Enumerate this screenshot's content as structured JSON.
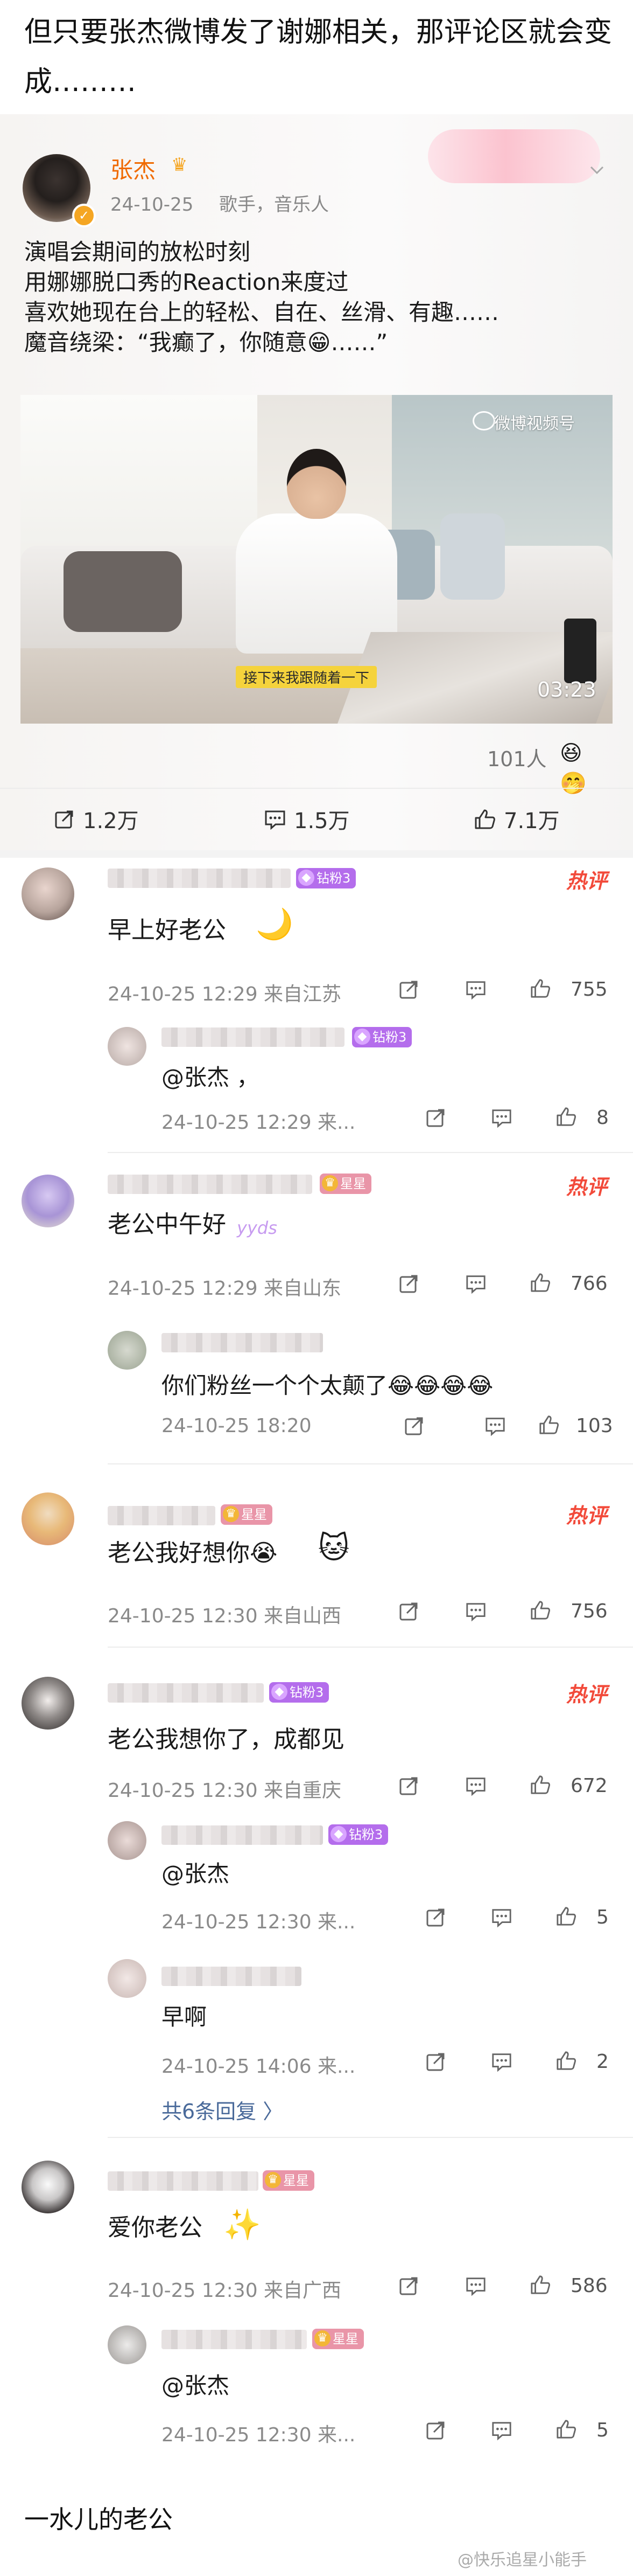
{
  "intro": {
    "line1": "但只要张杰微博发了谢娜相关，那评论区就会变",
    "line2": "成………"
  },
  "post": {
    "author": "张杰",
    "date": "24-10-25",
    "tags": "歌手，音乐人",
    "text_lines": [
      "演唱会期间的放松时刻",
      "用娜娜脱口秀的Reaction来度过",
      "喜欢她现在台上的轻松、自在、丝滑、有趣……",
      "魔音绕梁：“我癫了，你随意😁……”"
    ],
    "video": {
      "watermark": "微博视频号",
      "subtitle": "接下来我跟随着一下",
      "duration": "03:23"
    },
    "views": "101人",
    "actions": {
      "share": "1.2万",
      "comment": "1.5万",
      "like": "7.1万"
    }
  },
  "comments": [
    {
      "badge": "钻粉3",
      "hot": "热评",
      "text": "早上好老公",
      "meta": "24-10-25 12:29  来自江苏",
      "likes": "755",
      "replies": [
        {
          "badge": "钻粉3",
          "text": "@张杰 ，",
          "meta": "24-10-25 12:29  来...",
          "likes": "8"
        }
      ]
    },
    {
      "badge": "星星",
      "hot": "热评",
      "text": "老公中午好",
      "sticker": "yyds",
      "meta": "24-10-25 12:29  来自山东",
      "likes": "766",
      "replies": [
        {
          "badge": "",
          "text": "你们粉丝一个个太颠了😂😂😂😂",
          "meta": "24-10-25 18:20",
          "likes": "103"
        }
      ]
    },
    {
      "badge": "星星",
      "hot": "热评",
      "text": "老公我好想你😭",
      "meta": "24-10-25 12:30  来自山西",
      "likes": "756",
      "replies": []
    },
    {
      "badge": "钻粉3",
      "hot": "热评",
      "text": "老公我想你了，成都见",
      "meta": "24-10-25 12:30  来自重庆",
      "likes": "672",
      "replies": [
        {
          "badge": "钻粉3",
          "text": "@张杰",
          "meta": "24-10-25 12:30  来...",
          "likes": "5"
        },
        {
          "badge": "",
          "text": "早啊",
          "meta": "24-10-25 14:06  来...",
          "likes": "2"
        }
      ],
      "more_replies": "共6条回复 〉"
    },
    {
      "badge": "星星",
      "hot": "",
      "text": "爱你老公",
      "meta": "24-10-25 12:30  来自广西",
      "likes": "586",
      "replies": [
        {
          "badge": "星星",
          "text": "@张杰",
          "meta": "24-10-25 12:30  来...",
          "likes": "5"
        }
      ]
    }
  ],
  "outro": "一水儿的老公",
  "footer_watermark": "@快乐追星小能手"
}
